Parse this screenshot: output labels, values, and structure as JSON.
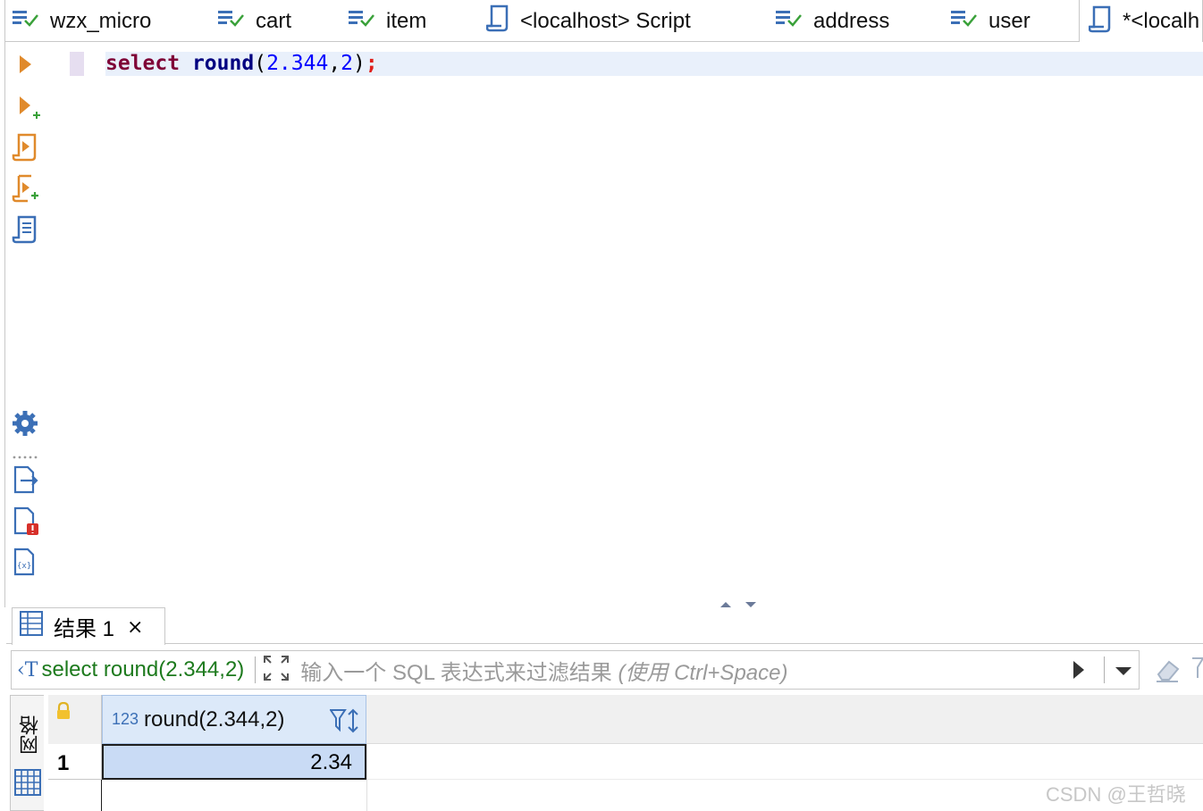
{
  "tabs": [
    {
      "label": "wzx_micro",
      "icon": "table-icon"
    },
    {
      "label": "cart",
      "icon": "table-icon"
    },
    {
      "label": "item",
      "icon": "table-icon"
    },
    {
      "label": "<localhost> Script",
      "icon": "script-icon"
    },
    {
      "label": "address",
      "icon": "table-icon"
    },
    {
      "label": "user",
      "icon": "table-icon"
    },
    {
      "label": "*<localh",
      "icon": "script-icon",
      "active": true
    }
  ],
  "editor": {
    "keyword": "select",
    "function": "round",
    "open": "(",
    "arg1": "2.344",
    "comma": ",",
    "arg2": "2",
    "close": ")",
    "semicolon": ";"
  },
  "gutter_icons": [
    "execute-statement-icon",
    "execute-new-tab-icon",
    "execute-script-icon",
    "execute-script-new-tab-icon",
    "explain-plan-icon",
    "settings-icon",
    "export-icon",
    "problems-icon",
    "variables-icon"
  ],
  "results": {
    "tab_label": "结果 1",
    "close_glyph": "⨯",
    "query_text": "select round(2.344,2)",
    "filter_placeholder": "输入一个 SQL 表达式来过滤结果",
    "filter_hint": "(使用 Ctrl+Space)",
    "view_mode_label": "网格",
    "column": {
      "type_badge": "123",
      "name": "round(2.344,2)"
    },
    "rows": [
      {
        "row_number": "1",
        "value": "2.34"
      }
    ]
  },
  "watermark": "CSDN @王哲晓",
  "colors": {
    "keyword": "#7f0037",
    "number": "#0000ff",
    "function": "#000080",
    "accent": "#3b6fb6",
    "icon_orange": "#e08a2c",
    "query_green": "#1d7a1d"
  }
}
